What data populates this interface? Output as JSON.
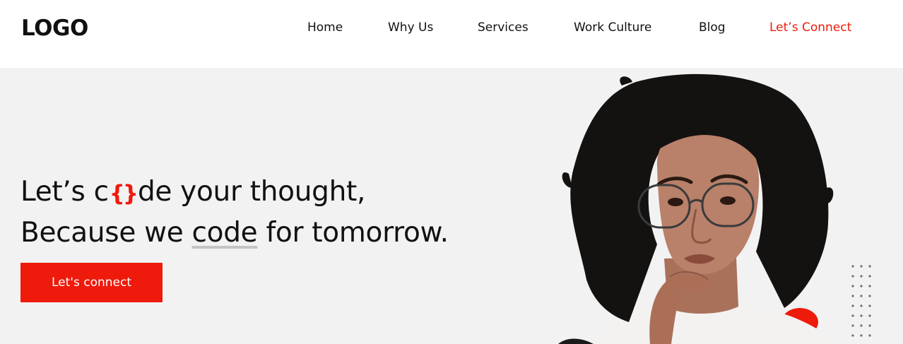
{
  "header": {
    "logo": "LOGO",
    "nav": {
      "home": "Home",
      "why_us": "Why Us",
      "services": "Services",
      "work_culture": "Work Culture",
      "blog": "Blog",
      "connect": "Let’s Connect"
    }
  },
  "hero": {
    "headline": {
      "line1_before": "Let’s c",
      "brace": "{}",
      "line1_after": "de your thought,",
      "line2_before": "Because we ",
      "line2_highlight": "code",
      "line2_after": " for tomorrow."
    },
    "button_label": "Let's connect"
  },
  "colors": {
    "accent": "#ee1a0b",
    "hero_background": "#f2f2f2",
    "text": "#111111"
  }
}
